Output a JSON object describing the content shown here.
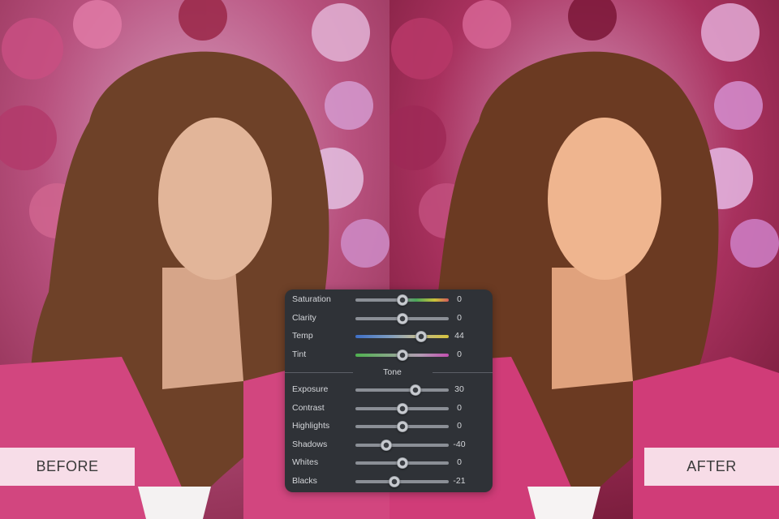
{
  "labels": {
    "before": "BEFORE",
    "after": "AFTER"
  },
  "panel": {
    "color_sliders": [
      {
        "label": "Saturation",
        "value": "0",
        "level": 0.5,
        "track": "saturation"
      },
      {
        "label": "Clarity",
        "value": "0",
        "level": 0.5,
        "track": "gray"
      },
      {
        "label": "Temp",
        "value": "44",
        "level": 0.7,
        "track": "temp"
      },
      {
        "label": "Tint",
        "value": "0",
        "level": 0.5,
        "track": "tint"
      }
    ],
    "tone_title": "Tone",
    "tone_sliders": [
      {
        "label": "Exposure",
        "value": "30",
        "level": 0.64
      },
      {
        "label": "Contrast",
        "value": "0",
        "level": 0.5
      },
      {
        "label": "Highlights",
        "value": "0",
        "level": 0.5
      },
      {
        "label": "Shadows",
        "value": "-40",
        "level": 0.33
      },
      {
        "label": "Whites",
        "value": "0",
        "level": 0.5
      },
      {
        "label": "Blacks",
        "value": "-21",
        "level": 0.42
      }
    ]
  },
  "colors": {
    "panel_bg": "#2f3237",
    "jacket_pink": "#d2467f",
    "hair_brown": "#6b3a22"
  }
}
